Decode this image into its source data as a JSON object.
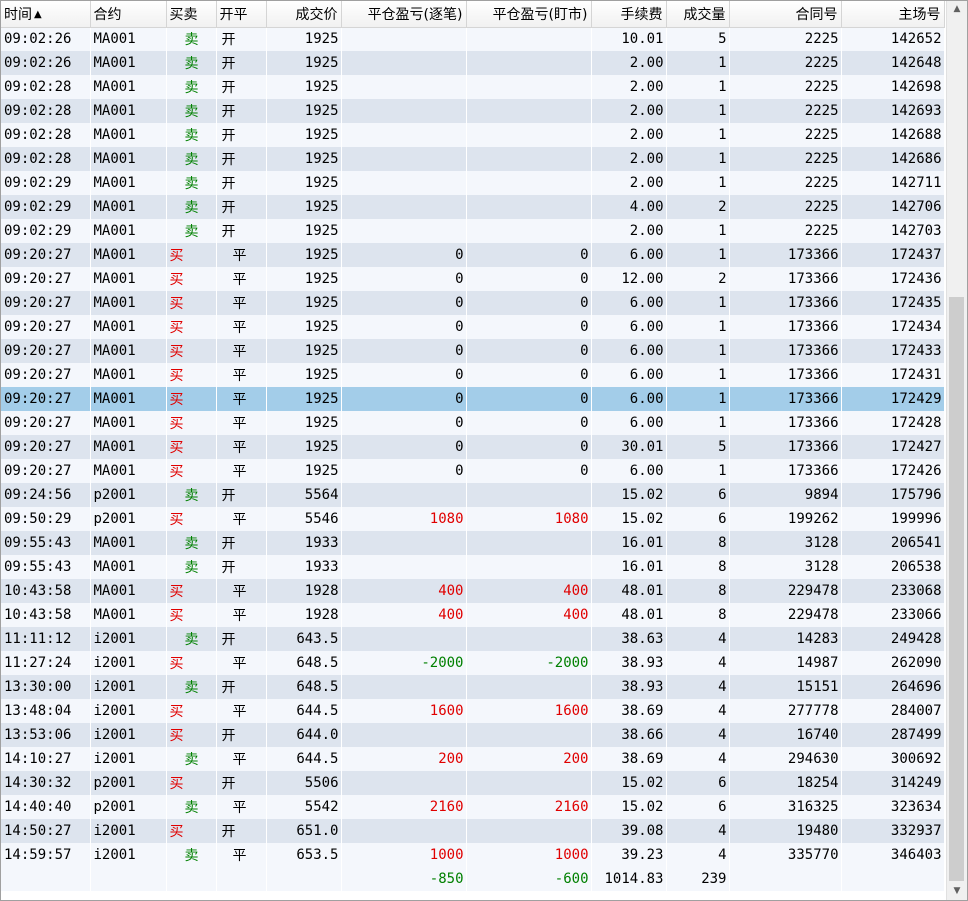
{
  "columns": [
    "时间",
    "合约",
    "买卖",
    "开平",
    "成交价",
    "平仓盈亏(逐笔)",
    "平仓盈亏(盯市)",
    "手续费",
    "成交量",
    "合同号",
    "主场号"
  ],
  "sort_indicator": "▲",
  "colors": {
    "buy": "#e00000",
    "sell": "#008000",
    "profit": "#e00000",
    "loss": "#008000",
    "selected_row": "#a3cde9"
  },
  "rows": [
    {
      "time": "09:02:26",
      "contract": "MA001",
      "side": "卖",
      "oc": "开",
      "price": "1925",
      "pnl_trade": "",
      "pnl_mtm": "",
      "fee": "10.01",
      "qty": "5",
      "order_no": "2225",
      "match_no": "142652"
    },
    {
      "time": "09:02:26",
      "contract": "MA001",
      "side": "卖",
      "oc": "开",
      "price": "1925",
      "pnl_trade": "",
      "pnl_mtm": "",
      "fee": "2.00",
      "qty": "1",
      "order_no": "2225",
      "match_no": "142648"
    },
    {
      "time": "09:02:28",
      "contract": "MA001",
      "side": "卖",
      "oc": "开",
      "price": "1925",
      "pnl_trade": "",
      "pnl_mtm": "",
      "fee": "2.00",
      "qty": "1",
      "order_no": "2225",
      "match_no": "142698"
    },
    {
      "time": "09:02:28",
      "contract": "MA001",
      "side": "卖",
      "oc": "开",
      "price": "1925",
      "pnl_trade": "",
      "pnl_mtm": "",
      "fee": "2.00",
      "qty": "1",
      "order_no": "2225",
      "match_no": "142693"
    },
    {
      "time": "09:02:28",
      "contract": "MA001",
      "side": "卖",
      "oc": "开",
      "price": "1925",
      "pnl_trade": "",
      "pnl_mtm": "",
      "fee": "2.00",
      "qty": "1",
      "order_no": "2225",
      "match_no": "142688"
    },
    {
      "time": "09:02:28",
      "contract": "MA001",
      "side": "卖",
      "oc": "开",
      "price": "1925",
      "pnl_trade": "",
      "pnl_mtm": "",
      "fee": "2.00",
      "qty": "1",
      "order_no": "2225",
      "match_no": "142686"
    },
    {
      "time": "09:02:29",
      "contract": "MA001",
      "side": "卖",
      "oc": "开",
      "price": "1925",
      "pnl_trade": "",
      "pnl_mtm": "",
      "fee": "2.00",
      "qty": "1",
      "order_no": "2225",
      "match_no": "142711"
    },
    {
      "time": "09:02:29",
      "contract": "MA001",
      "side": "卖",
      "oc": "开",
      "price": "1925",
      "pnl_trade": "",
      "pnl_mtm": "",
      "fee": "4.00",
      "qty": "2",
      "order_no": "2225",
      "match_no": "142706"
    },
    {
      "time": "09:02:29",
      "contract": "MA001",
      "side": "卖",
      "oc": "开",
      "price": "1925",
      "pnl_trade": "",
      "pnl_mtm": "",
      "fee": "2.00",
      "qty": "1",
      "order_no": "2225",
      "match_no": "142703"
    },
    {
      "time": "09:20:27",
      "contract": "MA001",
      "side": "买",
      "oc": "平",
      "price": "1925",
      "pnl_trade": "0",
      "pnl_mtm": "0",
      "fee": "6.00",
      "qty": "1",
      "order_no": "173366",
      "match_no": "172437"
    },
    {
      "time": "09:20:27",
      "contract": "MA001",
      "side": "买",
      "oc": "平",
      "price": "1925",
      "pnl_trade": "0",
      "pnl_mtm": "0",
      "fee": "12.00",
      "qty": "2",
      "order_no": "173366",
      "match_no": "172436"
    },
    {
      "time": "09:20:27",
      "contract": "MA001",
      "side": "买",
      "oc": "平",
      "price": "1925",
      "pnl_trade": "0",
      "pnl_mtm": "0",
      "fee": "6.00",
      "qty": "1",
      "order_no": "173366",
      "match_no": "172435"
    },
    {
      "time": "09:20:27",
      "contract": "MA001",
      "side": "买",
      "oc": "平",
      "price": "1925",
      "pnl_trade": "0",
      "pnl_mtm": "0",
      "fee": "6.00",
      "qty": "1",
      "order_no": "173366",
      "match_no": "172434"
    },
    {
      "time": "09:20:27",
      "contract": "MA001",
      "side": "买",
      "oc": "平",
      "price": "1925",
      "pnl_trade": "0",
      "pnl_mtm": "0",
      "fee": "6.00",
      "qty": "1",
      "order_no": "173366",
      "match_no": "172433"
    },
    {
      "time": "09:20:27",
      "contract": "MA001",
      "side": "买",
      "oc": "平",
      "price": "1925",
      "pnl_trade": "0",
      "pnl_mtm": "0",
      "fee": "6.00",
      "qty": "1",
      "order_no": "173366",
      "match_no": "172431"
    },
    {
      "time": "09:20:27",
      "contract": "MA001",
      "side": "买",
      "oc": "平",
      "price": "1925",
      "pnl_trade": "0",
      "pnl_mtm": "0",
      "fee": "6.00",
      "qty": "1",
      "order_no": "173366",
      "match_no": "172429",
      "selected": true
    },
    {
      "time": "09:20:27",
      "contract": "MA001",
      "side": "买",
      "oc": "平",
      "price": "1925",
      "pnl_trade": "0",
      "pnl_mtm": "0",
      "fee": "6.00",
      "qty": "1",
      "order_no": "173366",
      "match_no": "172428"
    },
    {
      "time": "09:20:27",
      "contract": "MA001",
      "side": "买",
      "oc": "平",
      "price": "1925",
      "pnl_trade": "0",
      "pnl_mtm": "0",
      "fee": "30.01",
      "qty": "5",
      "order_no": "173366",
      "match_no": "172427"
    },
    {
      "time": "09:20:27",
      "contract": "MA001",
      "side": "买",
      "oc": "平",
      "price": "1925",
      "pnl_trade": "0",
      "pnl_mtm": "0",
      "fee": "6.00",
      "qty": "1",
      "order_no": "173366",
      "match_no": "172426"
    },
    {
      "time": "09:24:56",
      "contract": "p2001",
      "side": "卖",
      "oc": "开",
      "price": "5564",
      "pnl_trade": "",
      "pnl_mtm": "",
      "fee": "15.02",
      "qty": "6",
      "order_no": "9894",
      "match_no": "175796"
    },
    {
      "time": "09:50:29",
      "contract": "p2001",
      "side": "买",
      "oc": "平",
      "price": "5546",
      "pnl_trade": "1080",
      "pnl_mtm": "1080",
      "fee": "15.02",
      "qty": "6",
      "order_no": "199262",
      "match_no": "199996"
    },
    {
      "time": "09:55:43",
      "contract": "MA001",
      "side": "卖",
      "oc": "开",
      "price": "1933",
      "pnl_trade": "",
      "pnl_mtm": "",
      "fee": "16.01",
      "qty": "8",
      "order_no": "3128",
      "match_no": "206541"
    },
    {
      "time": "09:55:43",
      "contract": "MA001",
      "side": "卖",
      "oc": "开",
      "price": "1933",
      "pnl_trade": "",
      "pnl_mtm": "",
      "fee": "16.01",
      "qty": "8",
      "order_no": "3128",
      "match_no": "206538"
    },
    {
      "time": "10:43:58",
      "contract": "MA001",
      "side": "买",
      "oc": "平",
      "price": "1928",
      "pnl_trade": "400",
      "pnl_mtm": "400",
      "fee": "48.01",
      "qty": "8",
      "order_no": "229478",
      "match_no": "233068"
    },
    {
      "time": "10:43:58",
      "contract": "MA001",
      "side": "买",
      "oc": "平",
      "price": "1928",
      "pnl_trade": "400",
      "pnl_mtm": "400",
      "fee": "48.01",
      "qty": "8",
      "order_no": "229478",
      "match_no": "233066"
    },
    {
      "time": "11:11:12",
      "contract": "i2001",
      "side": "卖",
      "oc": "开",
      "price": "643.5",
      "pnl_trade": "",
      "pnl_mtm": "",
      "fee": "38.63",
      "qty": "4",
      "order_no": "14283",
      "match_no": "249428"
    },
    {
      "time": "11:27:24",
      "contract": "i2001",
      "side": "买",
      "oc": "平",
      "price": "648.5",
      "pnl_trade": "-2000",
      "pnl_mtm": "-2000",
      "fee": "38.93",
      "qty": "4",
      "order_no": "14987",
      "match_no": "262090"
    },
    {
      "time": "13:30:00",
      "contract": "i2001",
      "side": "卖",
      "oc": "开",
      "price": "648.5",
      "pnl_trade": "",
      "pnl_mtm": "",
      "fee": "38.93",
      "qty": "4",
      "order_no": "15151",
      "match_no": "264696"
    },
    {
      "time": "13:48:04",
      "contract": "i2001",
      "side": "买",
      "oc": "平",
      "price": "644.5",
      "pnl_trade": "1600",
      "pnl_mtm": "1600",
      "fee": "38.69",
      "qty": "4",
      "order_no": "277778",
      "match_no": "284007"
    },
    {
      "time": "13:53:06",
      "contract": "i2001",
      "side": "买",
      "oc": "开",
      "price": "644.0",
      "pnl_trade": "",
      "pnl_mtm": "",
      "fee": "38.66",
      "qty": "4",
      "order_no": "16740",
      "match_no": "287499"
    },
    {
      "time": "14:10:27",
      "contract": "i2001",
      "side": "卖",
      "oc": "平",
      "price": "644.5",
      "pnl_trade": "200",
      "pnl_mtm": "200",
      "fee": "38.69",
      "qty": "4",
      "order_no": "294630",
      "match_no": "300692"
    },
    {
      "time": "14:30:32",
      "contract": "p2001",
      "side": "买",
      "oc": "开",
      "price": "5506",
      "pnl_trade": "",
      "pnl_mtm": "",
      "fee": "15.02",
      "qty": "6",
      "order_no": "18254",
      "match_no": "314249"
    },
    {
      "time": "14:40:40",
      "contract": "p2001",
      "side": "卖",
      "oc": "平",
      "price": "5542",
      "pnl_trade": "2160",
      "pnl_mtm": "2160",
      "fee": "15.02",
      "qty": "6",
      "order_no": "316325",
      "match_no": "323634"
    },
    {
      "time": "14:50:27",
      "contract": "i2001",
      "side": "买",
      "oc": "开",
      "price": "651.0",
      "pnl_trade": "",
      "pnl_mtm": "",
      "fee": "39.08",
      "qty": "4",
      "order_no": "19480",
      "match_no": "332937"
    },
    {
      "time": "14:59:57",
      "contract": "i2001",
      "side": "卖",
      "oc": "平",
      "price": "653.5",
      "pnl_trade": "1000",
      "pnl_mtm": "1000",
      "fee": "39.23",
      "qty": "4",
      "order_no": "335770",
      "match_no": "346403"
    }
  ],
  "totals": {
    "pnl_trade": "-850",
    "pnl_mtm": "-600",
    "fee": "1014.83",
    "qty": "239"
  },
  "scrollbar": {
    "up_icon": "up-arrow-icon",
    "down_icon": "down-arrow-icon"
  }
}
